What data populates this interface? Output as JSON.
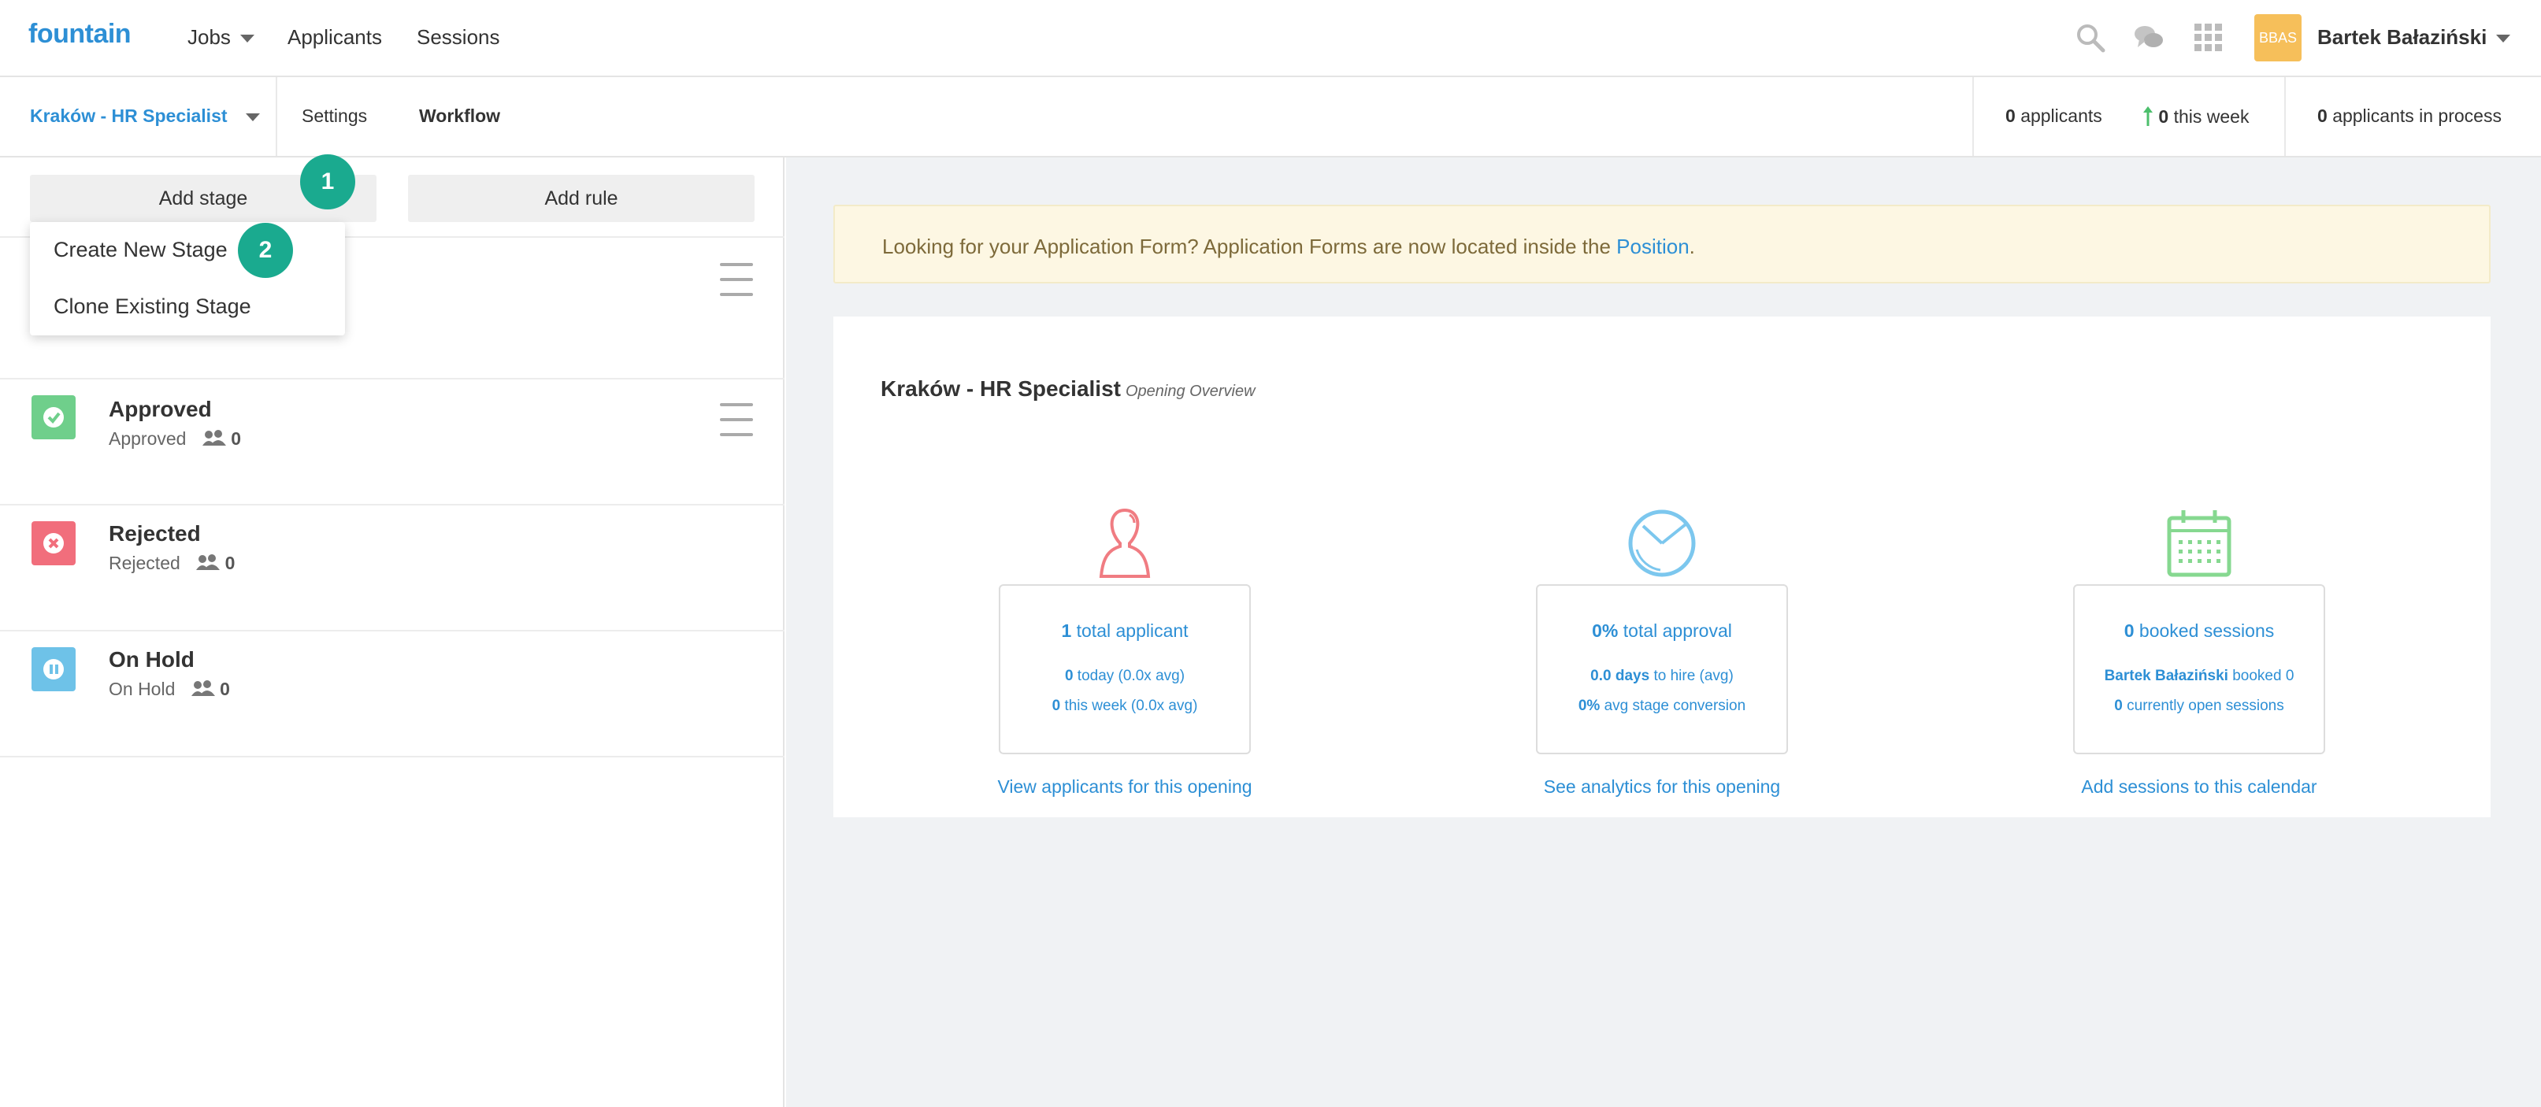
{
  "topnav": {
    "logo": "fountain",
    "links": [
      "Jobs",
      "Applicants",
      "Sessions"
    ],
    "avatar_text": "BBAS",
    "username": "Bartek Bałaziński"
  },
  "subnav": {
    "opening": "Kraków - HR Specialist",
    "links": [
      "Settings",
      "Workflow"
    ],
    "applicants_count": "0",
    "applicants_label": "applicants",
    "week_count": "0",
    "week_label": "this week",
    "in_process_count": "0",
    "in_process_label": "applicants in process"
  },
  "toolbar": {
    "add_stage": "Add stage",
    "add_rule": "Add rule"
  },
  "dropdown": {
    "items": [
      "Create New Stage",
      "Clone Existing Stage"
    ]
  },
  "badges": [
    "1",
    "2"
  ],
  "stages": [
    {
      "title": "Approved",
      "type": "Approved",
      "count": "0",
      "color": "#6fcf8b",
      "icon": "check-icon"
    },
    {
      "title": "Rejected",
      "type": "Rejected",
      "count": "0",
      "color": "#f16e7c",
      "icon": "x-icon"
    },
    {
      "title": "On Hold",
      "type": "On Hold",
      "count": "0",
      "color": "#6ec2e8",
      "icon": "pause-icon"
    }
  ],
  "banner": {
    "text": "Looking for your Application Form? Application Forms are now located inside the ",
    "link": "Position",
    "end": "."
  },
  "overview": {
    "title": "Kraków - HR Specialist",
    "subtitle": "Opening Overview",
    "cards": [
      {
        "icon": "person-icon",
        "title_num": "1",
        "title_text": "total applicant",
        "line1_num": "0",
        "line1_text": "today (0.0x avg)",
        "line2_num": "0",
        "line2_text": "this week (0.0x avg)",
        "link": "View applicants for this opening"
      },
      {
        "icon": "pie-chart-icon",
        "title_num": "0%",
        "title_text": "total approval",
        "line1_num": "0.0 days",
        "line1_text": "to hire (avg)",
        "line2_num": "0%",
        "line2_text": "avg stage conversion",
        "link": "See analytics for this opening"
      },
      {
        "icon": "calendar-icon",
        "title_num": "0",
        "title_text": "booked sessions",
        "line1_num": "Bartek Bałaziński",
        "line1_text": "booked 0",
        "line2_num": "0",
        "line2_text": "currently open sessions",
        "link": "Add sessions to this calendar"
      }
    ]
  },
  "colors": {
    "brand": "#2d8fd5",
    "badge": "#1aaa8f",
    "banner_bg": "#fdf7e3"
  }
}
